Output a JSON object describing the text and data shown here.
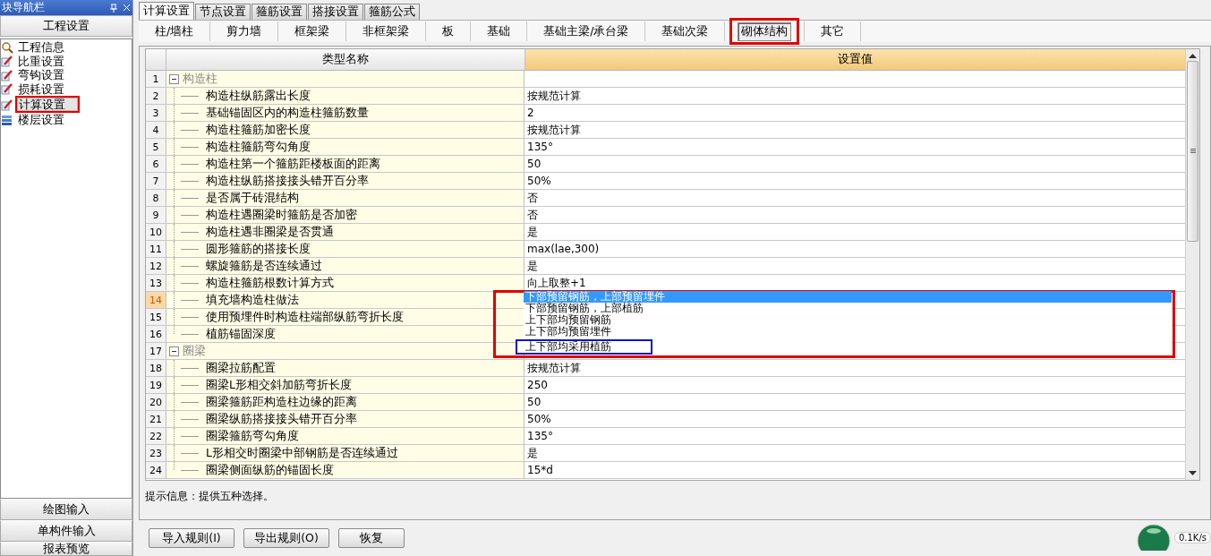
{
  "nav_panel": {
    "title": "块导航栏",
    "section": "工程设置",
    "items": [
      {
        "label": "工程信息",
        "kind": "magnifier",
        "selected": false,
        "annotated": false
      },
      {
        "label": "比重设置",
        "kind": "pencil",
        "selected": false,
        "annotated": false
      },
      {
        "label": "弯钩设置",
        "kind": "pencil",
        "selected": false,
        "annotated": false
      },
      {
        "label": "损耗设置",
        "kind": "pencil",
        "selected": false,
        "annotated": false
      },
      {
        "label": "计算设置",
        "kind": "pencil",
        "selected": true,
        "annotated": true
      },
      {
        "label": "楼层设置",
        "kind": "layers",
        "selected": false,
        "annotated": false
      }
    ],
    "bottom_buttons": [
      "绘图输入",
      "单构件输入",
      "报表预览"
    ]
  },
  "tabs": [
    {
      "label": "计算设置",
      "selected": true
    },
    {
      "label": "节点设置",
      "selected": false
    },
    {
      "label": "箍筋设置",
      "selected": false
    },
    {
      "label": "搭接设置",
      "selected": false
    },
    {
      "label": "箍筋公式",
      "selected": false
    }
  ],
  "subtabs": [
    {
      "label": "柱/墙柱",
      "selected": false,
      "annotated": false
    },
    {
      "label": "剪力墙",
      "selected": false,
      "annotated": false
    },
    {
      "label": "框架梁",
      "selected": false,
      "annotated": false
    },
    {
      "label": "非框架梁",
      "selected": false,
      "annotated": false
    },
    {
      "label": "板",
      "selected": false,
      "annotated": false
    },
    {
      "label": "基础",
      "selected": false,
      "annotated": false
    },
    {
      "label": "基础主梁/承台梁",
      "selected": false,
      "annotated": false
    },
    {
      "label": "基础次梁",
      "selected": false,
      "annotated": false
    },
    {
      "label": "砌体结构",
      "selected": true,
      "annotated": true
    },
    {
      "label": "其它",
      "selected": false,
      "annotated": false
    }
  ],
  "table": {
    "columns": [
      "类型名称",
      "设置值"
    ],
    "rows": [
      {
        "no": "1",
        "kind": "category",
        "name": "构造柱",
        "expanded": true,
        "selected": false
      },
      {
        "no": "2",
        "kind": "setting",
        "name": "构造柱纵筋露出长度",
        "value": "按规范计算",
        "selected": false
      },
      {
        "no": "3",
        "kind": "setting",
        "name": "基础锚固区内的构造柱箍筋数量",
        "value": "2",
        "selected": false
      },
      {
        "no": "4",
        "kind": "setting",
        "name": "构造柱箍筋加密长度",
        "value": "按规范计算",
        "selected": false
      },
      {
        "no": "5",
        "kind": "setting",
        "name": "构造柱箍筋弯勾角度",
        "value": "135°",
        "selected": false
      },
      {
        "no": "6",
        "kind": "setting",
        "name": "构造柱第一个箍筋距楼板面的距离",
        "value": "50",
        "selected": false
      },
      {
        "no": "7",
        "kind": "setting",
        "name": "构造柱纵筋搭接接头错开百分率",
        "value": "50%",
        "selected": false
      },
      {
        "no": "8",
        "kind": "setting",
        "name": "是否属于砖混结构",
        "value": "否",
        "selected": false
      },
      {
        "no": "9",
        "kind": "setting",
        "name": "构造柱遇圈梁时箍筋是否加密",
        "value": "否",
        "selected": false
      },
      {
        "no": "10",
        "kind": "setting",
        "name": "构造柱遇非圈梁是否贯通",
        "value": "是",
        "selected": false
      },
      {
        "no": "11",
        "kind": "setting",
        "name": "圆形箍筋的搭接长度",
        "value": "max(lae,300)",
        "selected": false
      },
      {
        "no": "12",
        "kind": "setting",
        "name": "螺旋箍筋是否连续通过",
        "value": "是",
        "selected": false
      },
      {
        "no": "13",
        "kind": "setting",
        "name": "构造柱箍筋根数计算方式",
        "value": "向上取整+1",
        "selected": false
      },
      {
        "no": "14",
        "kind": "setting",
        "name": "填充墙构造柱做法",
        "selected": true,
        "dropdown": {
          "annotated": true,
          "options": [
            {
              "label": "下部预留钢筋，上部预留埋件",
              "selected": true,
              "annotated": false
            },
            {
              "label": "下部预留钢筋，上部植筋",
              "selected": false,
              "annotated": false
            },
            {
              "label": "上下部均预留钢筋",
              "selected": false,
              "annotated": false
            },
            {
              "label": "上下部均预留埋件",
              "selected": false,
              "annotated": false
            },
            {
              "label": "上下部均采用植筋",
              "selected": false,
              "annotated": true
            }
          ]
        }
      },
      {
        "no": "15",
        "kind": "setting",
        "name": "使用预埋件时构造柱端部纵筋弯折长度",
        "selected": false
      },
      {
        "no": "16",
        "kind": "setting",
        "name": "植筋锚固深度",
        "selected": false
      },
      {
        "no": "17",
        "kind": "category",
        "name": "圈梁",
        "expanded": true,
        "selected": false
      },
      {
        "no": "18",
        "kind": "setting",
        "name": "圈梁拉筋配置",
        "value": "按规范计算",
        "selected": false
      },
      {
        "no": "19",
        "kind": "setting",
        "name": "圈梁L形相交斜加筋弯折长度",
        "value": "250",
        "selected": false
      },
      {
        "no": "20",
        "kind": "setting",
        "name": "圈梁箍筋距构造柱边缘的距离",
        "value": "50",
        "selected": false
      },
      {
        "no": "21",
        "kind": "setting",
        "name": "圈梁纵筋搭接接头错开百分率",
        "value": "50%",
        "selected": false
      },
      {
        "no": "22",
        "kind": "setting",
        "name": "圈梁箍筋弯勾角度",
        "value": "135°",
        "selected": false
      },
      {
        "no": "23",
        "kind": "setting",
        "name": "L形相交时圈梁中部钢筋是否连续通过",
        "value": "是",
        "selected": false
      },
      {
        "no": "24",
        "kind": "setting",
        "name": "圈梁侧面纵筋的锚固长度",
        "value": "15*d",
        "selected": false
      }
    ]
  },
  "hint": "提示信息：提供五种选择。",
  "buttons": [
    "导入规则(I)",
    "导出规则(O)",
    "恢复"
  ],
  "status": {
    "speed": "0.1K/s"
  }
}
